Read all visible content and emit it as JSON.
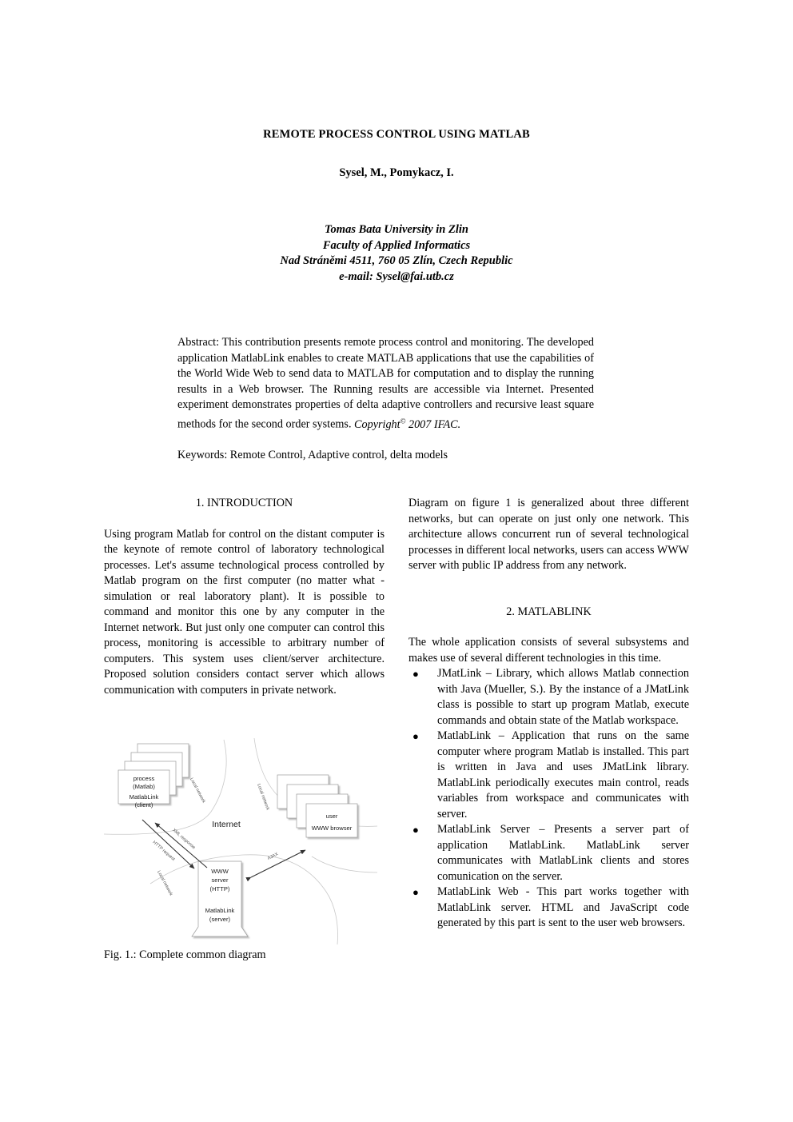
{
  "document": {
    "title": "REMOTE PROCESS CONTROL USING MATLAB",
    "authors": "Sysel, M., Pomykacz, I.",
    "affiliation": {
      "line1": "Tomas Bata University in Zlin",
      "line2": "Faculty of Applied Informatics",
      "line3": "Nad Stráněmi 4511, 760 05 Zlín, Czech Republic",
      "line4": "e-mail: Sysel@fai.utb.cz"
    },
    "abstract": {
      "body": "Abstract: This contribution presents remote process control and monitoring. The developed application MatlabLink enables to create MATLAB applications that use the capabilities of the World Wide Web to send data to MATLAB for computation and to display the running results in a Web browser. The Running results are accessible via Internet. Presented experiment demonstrates properties of delta adaptive controllers and recursive least square methods for the second order systems. ",
      "copyright": "Copyright",
      "copyright_symbol": "©",
      "copyright_rest": " 2007 IFAC.",
      "keywords": "Keywords: Remote Control, Adaptive control, delta models"
    }
  },
  "left_column": {
    "section_1_heading": "1.  INTRODUCTION",
    "paragraph_1": "Using program Matlab for control on the distant computer is the keynote of remote control of laboratory technological processes. Let's assume technological process controlled by Matlab program on the first computer (no matter what - simulation or real laboratory plant). It is possible to command and monitor this one by any computer in the Internet network. But just only one computer can control this process, monitoring is accessible to arbitrary number of computers. This system uses client/server architecture. Proposed solution considers contact server which allows communication with computers in private network.",
    "figure_caption": "Fig. 1.: Complete common diagram"
  },
  "right_column": {
    "paragraph_1": "Diagram on figure 1 is generalized about three different networks, but can operate on just only one network. This architecture allows concurrent run of several technological processes in different local networks, users can access WWW server with public IP address from any network.",
    "section_2_heading": "2.  MATLABLINK",
    "paragraph_2": "The whole application consists of several subsystems and makes use of several different technologies in this time.",
    "bullet_marker": "●",
    "bullets": [
      "JMatLink – Library, which allows Matlab connection with Java (Mueller, S.). By the instance of a JMatLink class is possible to start up program Matlab, execute commands and obtain state of the Matlab workspace.",
      "MatlabLink – Application that runs on the same computer where program Matlab is installed. This part is written in Java and uses JMatLink library. MatlabLink periodically executes main control, reads variables from workspace and communicates with server.",
      "MatlabLink Server – Presents a server part of application MatlabLink. MatlabLink server communicates with MatlabLink clients and stores comunication on the server.",
      "MatlabLink Web - This part works together with MatlabLink server. HTML and JavaScript code generated by this part is sent to the user web browsers."
    ]
  },
  "figure_1": {
    "nodes": {
      "process_line1": "process",
      "process_line2": "(Matlab)",
      "process_line3": "MatlabLink",
      "process_line4": "(client)",
      "user_line1": "user",
      "user_line2": "WWW browser",
      "server_line1": "WWW",
      "server_line2": "server",
      "server_line3": "(HTTP)",
      "server_line4": "MatlabLink",
      "server_line5": "(server)"
    },
    "labels": {
      "internet": "Internet",
      "local_network_1": "Local network",
      "local_network_2": "Local network",
      "local_network_3": "Local network",
      "xml_response": "XML response",
      "http_request": "HTTP request",
      "ajax": "AJAX"
    }
  }
}
